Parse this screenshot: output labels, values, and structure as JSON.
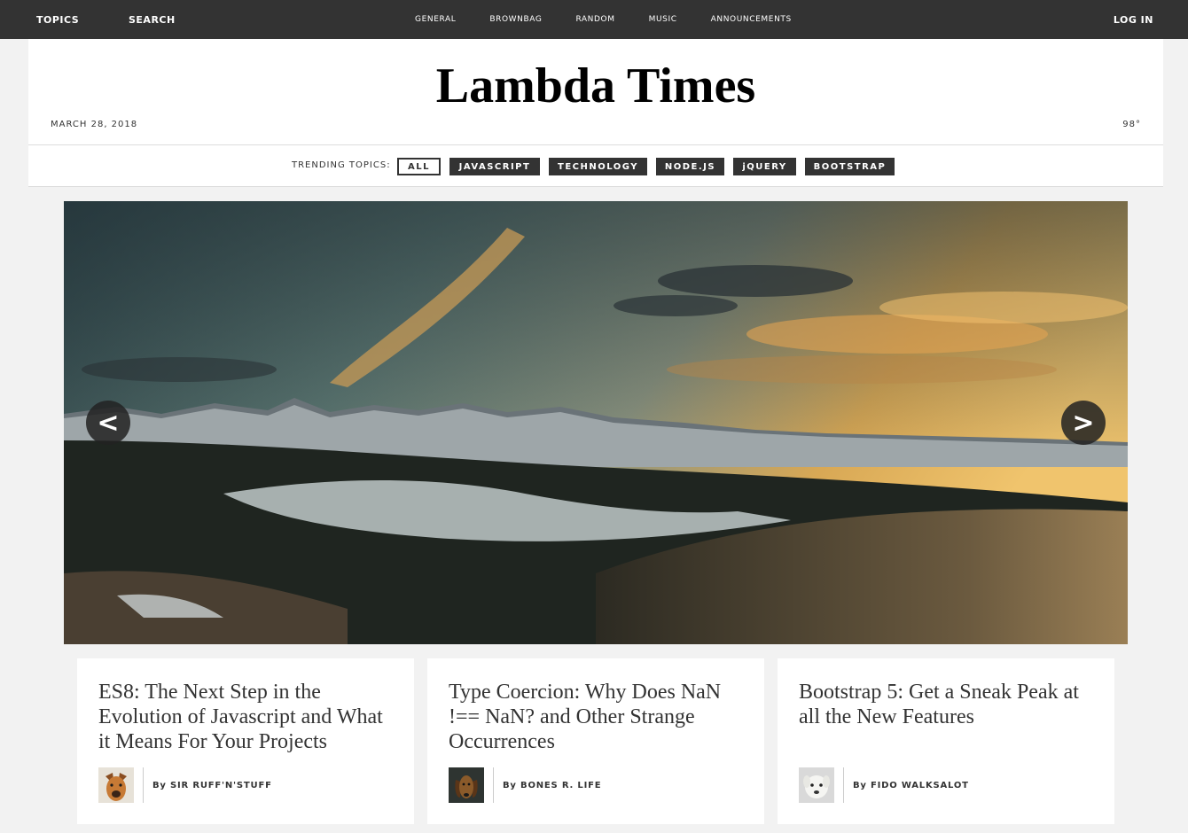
{
  "topbar": {
    "topics_label": "TOPICS",
    "search_label": "SEARCH",
    "nav": [
      "GENERAL",
      "BROWNBAG",
      "RANDOM",
      "MUSIC",
      "ANNOUNCEMENTS"
    ],
    "login_label": "LOG IN"
  },
  "header": {
    "title": "Lambda Times",
    "date": "MARCH 28, 2018",
    "temperature": "98°"
  },
  "topics": {
    "label": "TRENDING TOPICS:",
    "tabs": [
      "ALL",
      "JAVASCRIPT",
      "TECHNOLOGY",
      "NODE.JS",
      "jQUERY",
      "BOOTSTRAP"
    ],
    "active": "ALL"
  },
  "carousel": {
    "image": "mountain-landscape-sunset",
    "prev_label": "<",
    "next_label": ">"
  },
  "cards": [
    {
      "headline": "ES8: The Next Step in the Evolution of Javascript and What it Means For Your Projects",
      "author": "By SIR RUFF'N'STUFF",
      "avatar": "dog-avatar"
    },
    {
      "headline": "Type Coercion: Why Does NaN !== NaN? and Other Strange Occurrences",
      "author": "By BONES R. LIFE",
      "avatar": "dog-avatar"
    },
    {
      "headline": "Bootstrap 5: Get a Sneak Peak at all the New Features",
      "author": "By FIDO WALKSALOT",
      "avatar": "dog-avatar"
    }
  ],
  "colors": {
    "topbar": "#333333",
    "background": "#f2f2f2",
    "tab": "#333333"
  }
}
